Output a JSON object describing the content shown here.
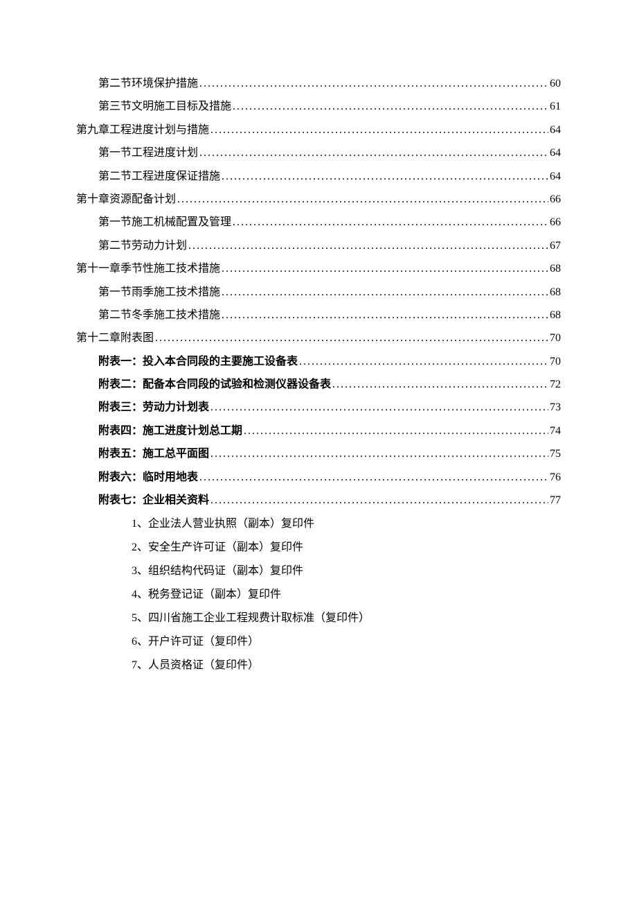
{
  "toc": [
    {
      "level": 2,
      "bold": false,
      "label": "第二节环境保护措施",
      "page": "60"
    },
    {
      "level": 2,
      "bold": false,
      "label": "第三节文明施工目标及措施",
      "page": "61"
    },
    {
      "level": 1,
      "bold": false,
      "label": "第九章工程进度计划与措施",
      "page": "64"
    },
    {
      "level": 2,
      "bold": false,
      "label": "第一节工程进度计划",
      "page": "64"
    },
    {
      "level": 2,
      "bold": false,
      "label": "第二节工程进度保证措施",
      "page": "64"
    },
    {
      "level": 1,
      "bold": false,
      "label": "第十章资源配备计划",
      "page": "66"
    },
    {
      "level": 2,
      "bold": false,
      "label": "第一节施工机械配置及管理",
      "page": "66"
    },
    {
      "level": 2,
      "bold": false,
      "label": "第二节劳动力计划",
      "page": "67"
    },
    {
      "level": 1,
      "bold": false,
      "label": "第十一章季节性施工技术措施",
      "page": "68"
    },
    {
      "level": 2,
      "bold": false,
      "label": "第一节雨季施工技术措施",
      "page": "68"
    },
    {
      "level": 2,
      "bold": false,
      "label": "第二节冬季施工技术措施",
      "page": "68"
    },
    {
      "level": 1,
      "bold": false,
      "label": "第十二章附表图",
      "page": "70"
    },
    {
      "level": 2,
      "bold": true,
      "label": "附表一：投入本合同段的主要施工设备表",
      "page": "70"
    },
    {
      "level": 2,
      "bold": true,
      "label": "附表二：配备本合同段的试验和检测仪器设备表",
      "page": "72"
    },
    {
      "level": 2,
      "bold": true,
      "label": "附表三：劳动力计划表",
      "page": "73"
    },
    {
      "level": 2,
      "bold": true,
      "label": "附表四：施工进度计划总工期",
      "page": "74"
    },
    {
      "level": 2,
      "bold": true,
      "label": "附表五：施工总平面图",
      "page": "75"
    },
    {
      "level": 2,
      "bold": true,
      "label": "附表六：临时用地表",
      "page": "76"
    },
    {
      "level": 2,
      "bold": true,
      "label": "附表七：企业相关资料",
      "page": "77"
    }
  ],
  "sublist": [
    "1、企业法人营业执照（副本）复印件",
    "2、安全生产许可证（副本）复印件",
    "3、组织结构代码证（副本）复印件",
    "4、税务登记证（副本）复印件",
    "5、四川省施工企业工程规费计取标准（复印件）",
    "6、开户许可证（复印件）",
    "7、人员资格证（复印件）"
  ]
}
